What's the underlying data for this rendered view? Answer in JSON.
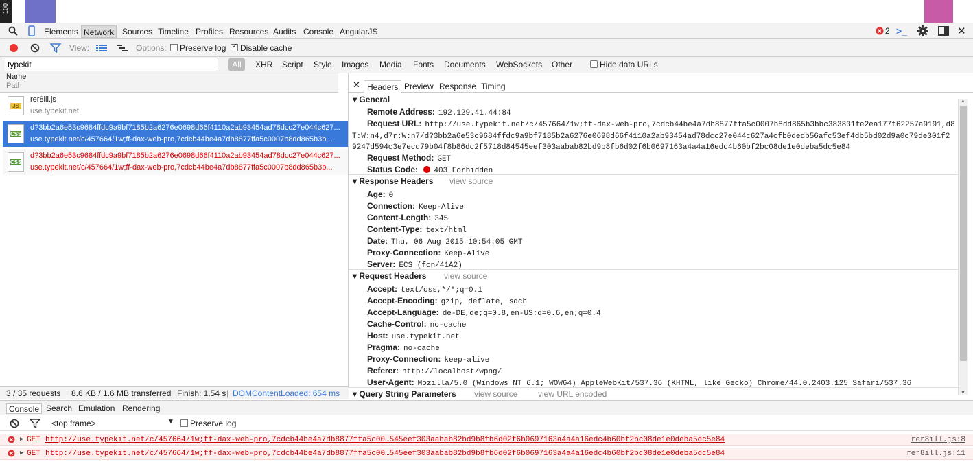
{
  "page": {
    "ruler_label": "100"
  },
  "mainbar": {
    "tabs": [
      "Elements",
      "Network",
      "Sources",
      "Timeline",
      "Profiles",
      "Resources",
      "Audits",
      "Console",
      "AngularJS"
    ],
    "error_count": "2"
  },
  "netbar": {
    "view_label": "View:",
    "options_label": "Options:",
    "preserve_log": "Preserve log",
    "disable_cache": "Disable cache"
  },
  "filterbar": {
    "filter_value": "typekit",
    "types": [
      "All",
      "XHR",
      "Script",
      "Style",
      "Images",
      "Media",
      "Fonts",
      "Documents",
      "WebSockets",
      "Other"
    ],
    "hide_data_urls": "Hide data URLs"
  },
  "requests": {
    "col_name": "Name",
    "col_path": "Path",
    "items": [
      {
        "name": "rer8ill.js",
        "path": "use.typekit.net",
        "type": "JS"
      },
      {
        "name": "d?3bb2a6e53c9684ffdc9a9bf7185b2a6276e0698d66f4110a2ab93454ad78dcc27e044c627...",
        "path": "use.typekit.net/c/457664/1w;ff-dax-web-pro,7cdcb44be4a7db8877ffa5c0007b8dd865b3b...",
        "type": "CSS"
      },
      {
        "name": "d?3bb2a6e53c9684ffdc9a9bf7185b2a6276e0698d66f4110a2ab93454ad78dcc27e044c627...",
        "path": "use.typekit.net/c/457664/1w;ff-dax-web-pro,7cdcb44be4a7db8877ffa5c0007b8dd865b3b...",
        "type": "CSS"
      }
    ]
  },
  "status": {
    "requests": "3 / 35 requests",
    "transferred": "8.6 KB / 1.6 MB transferred",
    "finish": "Finish: 1.54 s",
    "dcl": "DOMContentLoaded: 654 ms"
  },
  "detail": {
    "tabs": [
      "Headers",
      "Preview",
      "Response",
      "Timing"
    ],
    "general_title": "General",
    "general": [
      {
        "k": "Remote Address:",
        "v": "192.129.41.44:84"
      },
      {
        "k": "Request URL:",
        "v": "http://use.typekit.net/c/457664/1w;ff-dax-web-pro,7cdcb44be4a7db8877ffa5c0007b8dd865b3bbc383831fe2ea177f62257a9191,d8"
      },
      {
        "k": "",
        "v": "T:W:n4,d7r:W:n7/d?3bb2a6e53c9684ffdc9a9bf7185b2a6276e0698d66f4110a2ab93454ad78dcc27e044c627a4cfb0dedb56afc53ef4db5bd02d9a0c79de301f2"
      },
      {
        "k": "",
        "v": "9247d594c3e7ecd79b04f8b86dc2f5718d84545eef303aabab82bd9b8fb6d02f6b0697163a4a4a16edc4b60bf2bc08de1e0deba5dc5e84"
      },
      {
        "k": "Request Method:",
        "v": "GET"
      },
      {
        "k": "Status Code:",
        "v": "403 Forbidden"
      }
    ],
    "response_title": "Response Headers",
    "view_source": "view source",
    "response": [
      {
        "k": "Age:",
        "v": "0"
      },
      {
        "k": "Connection:",
        "v": "Keep-Alive"
      },
      {
        "k": "Content-Length:",
        "v": "345"
      },
      {
        "k": "Content-Type:",
        "v": "text/html"
      },
      {
        "k": "Date:",
        "v": "Thu, 06 Aug 2015 10:54:05 GMT"
      },
      {
        "k": "Proxy-Connection:",
        "v": "Keep-Alive"
      },
      {
        "k": "Server:",
        "v": "ECS (fcn/41A2)"
      }
    ],
    "request_title": "Request Headers",
    "request": [
      {
        "k": "Accept:",
        "v": "text/css,*/*;q=0.1"
      },
      {
        "k": "Accept-Encoding:",
        "v": "gzip, deflate, sdch"
      },
      {
        "k": "Accept-Language:",
        "v": "de-DE,de;q=0.8,en-US;q=0.6,en;q=0.4"
      },
      {
        "k": "Cache-Control:",
        "v": "no-cache"
      },
      {
        "k": "Host:",
        "v": "use.typekit.net"
      },
      {
        "k": "Pragma:",
        "v": "no-cache"
      },
      {
        "k": "Proxy-Connection:",
        "v": "keep-alive"
      },
      {
        "k": "Referer:",
        "v": "http://localhost/wpng/"
      },
      {
        "k": "User-Agent:",
        "v": "Mozilla/5.0 (Windows NT 6.1; WOW64) AppleWebKit/537.36 (KHTML, like Gecko) Chrome/44.0.2403.125 Safari/537.36"
      }
    ],
    "query_title": "Query String Parameters",
    "view_url_encoded": "view URL encoded"
  },
  "drawer": {
    "tabs": [
      "Console",
      "Search",
      "Emulation",
      "Rendering"
    ],
    "frame": "<top frame>",
    "preserve_log": "Preserve log",
    "errors": [
      {
        "method": "GET",
        "url": "http://use.typekit.net/c/457664/1w;ff-dax-web-pro,7cdcb44be4a7db8877ffa5c00…545eef303aabab82bd9b8fb6d02f6b0697163a4a4a16edc4b60bf2bc08de1e0deba5dc5e84",
        "src": "rer8ill.js:8"
      },
      {
        "method": "GET",
        "url": "http://use.typekit.net/c/457664/1w;ff-dax-web-pro,7cdcb44be4a7db8877ffa5c00…545eef303aabab82bd9b8fb6d02f6b0697163a4a4a16edc4b60bf2bc08de1e0deba5dc5e84",
        "src": "rer8ill.js:11"
      }
    ]
  },
  "colors": {
    "accent": "#3879d9",
    "error": "#d00",
    "record": "#e33"
  }
}
